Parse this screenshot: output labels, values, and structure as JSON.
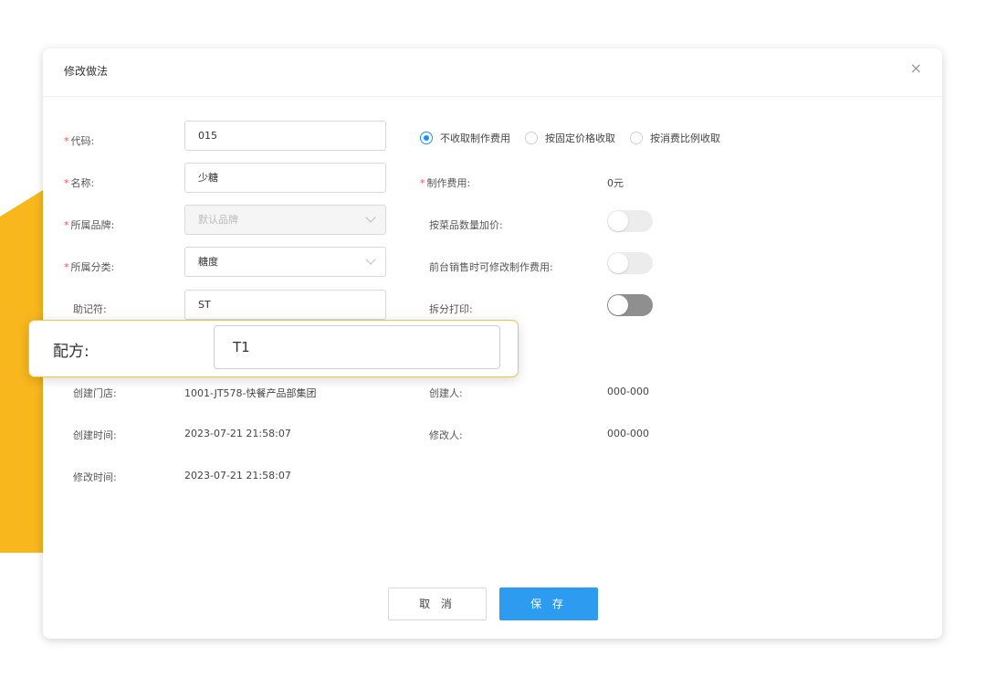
{
  "dialog": {
    "title": "修改做法",
    "close_icon": "×",
    "required_mark": "*"
  },
  "form": {
    "code": {
      "label": "代码:",
      "value": "015"
    },
    "name": {
      "label": "名称:",
      "value": "少糖"
    },
    "brand": {
      "label": "所属品牌:",
      "value": "默认品牌"
    },
    "category": {
      "label": "所属分类:",
      "value": "糖度"
    },
    "mnemonic": {
      "label": "助记符:",
      "value": "ST"
    },
    "store": {
      "label": "创建门店:",
      "value": "1001-JT578-快餐产品部集团"
    },
    "created_time": {
      "label": "创建时间:",
      "value": "2023-07-21 21:58:07"
    },
    "modified_time": {
      "label": "修改时间:",
      "value": "2023-07-21 21:58:07"
    }
  },
  "fee_options": [
    {
      "label": "不收取制作费用",
      "checked": true
    },
    {
      "label": "按固定价格收取",
      "checked": false
    },
    {
      "label": "按消费比例收取",
      "checked": false
    }
  ],
  "right": {
    "fee": {
      "label": "制作费用:",
      "value": "0元"
    },
    "qty_markup": {
      "label": "按菜品数量加价:",
      "enabled": false
    },
    "pos_editable": {
      "label": "前台销售时可修改制作费用:",
      "enabled": false
    },
    "split_print": {
      "label": "拆分打印:",
      "enabled": false
    },
    "creator": {
      "label": "创建人:",
      "value": "000-000"
    },
    "modifier": {
      "label": "修改人:",
      "value": "000-000"
    }
  },
  "callout": {
    "label": "配方:",
    "value": "T1"
  },
  "buttons": {
    "cancel": "取 消",
    "save": "保 存"
  },
  "colors": {
    "accent": "#2d9bf0",
    "required": "#ff4d4f",
    "highlight": "#f7b71d"
  }
}
